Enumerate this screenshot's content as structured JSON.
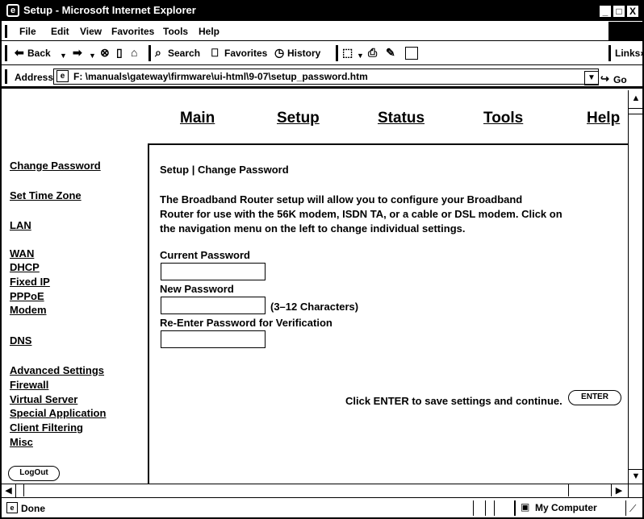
{
  "window": {
    "title": "Setup - Microsoft Internet Explorer",
    "minimize_label": "_",
    "restore_label": "□",
    "close_label": "X"
  },
  "menu": [
    "File",
    "Edit",
    "View",
    "Favorites",
    "Tools",
    "Help"
  ],
  "toolbar": {
    "back_label": "Back",
    "search_label": "Search",
    "favorites_label": "Favorites",
    "history_label": "History",
    "links_label": "Links",
    "links_chevron": "»"
  },
  "address": {
    "label": "Address",
    "url": "F: \\manuals\\gateway\\firmware\\ui-html\\9-07\\setup_password.htm",
    "go_label": "Go"
  },
  "topnav": [
    "Main",
    "Setup",
    "Status",
    "Tools",
    "Help"
  ],
  "sidebar": {
    "items": [
      "Change Password",
      "Set Time Zone",
      "LAN",
      "WAN",
      "DHCP",
      "Fixed IP",
      "PPPoE",
      "Modem",
      "DNS",
      "Advanced Settings",
      "Firewall",
      "Virtual Server",
      "Special Application",
      "Client Filtering",
      "Misc"
    ],
    "logout_label": "LogOut"
  },
  "panel": {
    "breadcrumb": "Setup | Change Password",
    "intro_lines": [
      "The Broadband Router setup will allow you to configure your Broadband",
      "Router for use with the 56K modem, ISDN TA, or a cable or DSL modem. Click on",
      "the navigation menu on the left to change individual settings."
    ],
    "current_password_label": "Current Password",
    "current_password_value": "",
    "new_password_label": "New Password",
    "new_password_value": "",
    "new_password_hint": "(3–12 Characters)",
    "reenter_label": "Re-Enter Password for Verification",
    "reenter_value": "",
    "enter_prompt": "Click ENTER to save settings and continue.",
    "enter_label": "ENTER"
  },
  "statusbar": {
    "status": "Done",
    "zone": "My Computer"
  }
}
